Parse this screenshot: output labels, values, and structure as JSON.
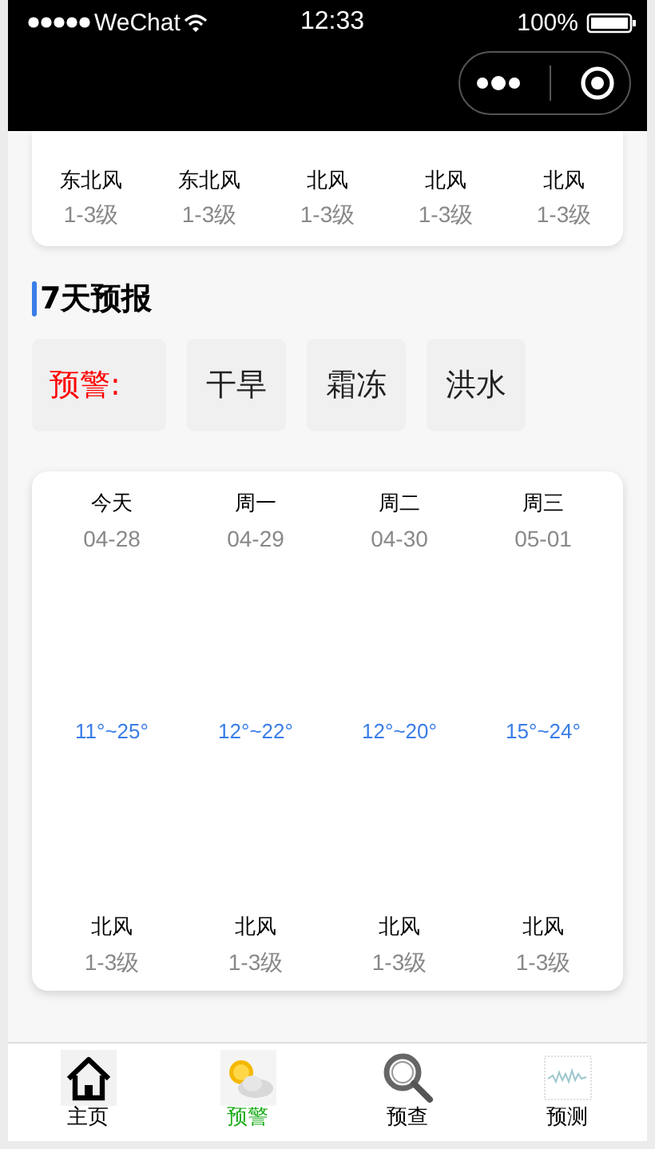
{
  "status_bar": {
    "carrier": "WeChat",
    "time": "12:33",
    "battery": "100%"
  },
  "top_card": {
    "winds": [
      {
        "direction": "东北风",
        "level": "1-3级"
      },
      {
        "direction": "东北风",
        "level": "1-3级"
      },
      {
        "direction": "北风",
        "level": "1-3级"
      },
      {
        "direction": "北风",
        "level": "1-3级"
      },
      {
        "direction": "北风",
        "level": "1-3级"
      }
    ]
  },
  "section_title": "7天预报",
  "warnings": {
    "label": "预警:",
    "items": [
      "干旱",
      "霜冻",
      "洪水"
    ]
  },
  "forecast": [
    {
      "day": "今天",
      "date": "04-28",
      "temp": "11°~25°",
      "wind": "北风",
      "level": "1-3级"
    },
    {
      "day": "周一",
      "date": "04-29",
      "temp": "12°~22°",
      "wind": "北风",
      "level": "1-3级"
    },
    {
      "day": "周二",
      "date": "04-30",
      "temp": "12°~20°",
      "wind": "北风",
      "level": "1-3级"
    },
    {
      "day": "周三",
      "date": "05-01",
      "temp": "15°~24°",
      "wind": "北风",
      "level": "1-3级"
    }
  ],
  "tab_bar": [
    {
      "kind": "home",
      "label": "主页",
      "selected": false
    },
    {
      "kind": "weather",
      "label": "预警",
      "selected": true
    },
    {
      "kind": "search",
      "label": "预查",
      "selected": false
    },
    {
      "kind": "chart",
      "label": "预测",
      "selected": false
    }
  ]
}
